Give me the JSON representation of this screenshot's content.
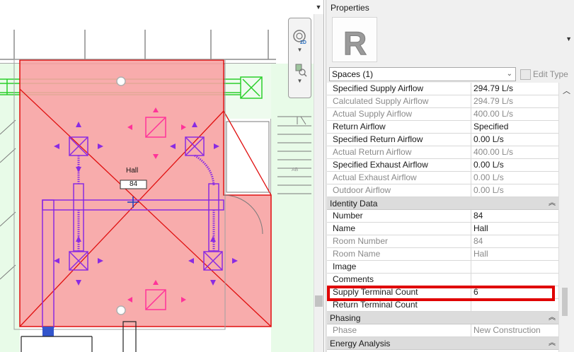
{
  "canvas": {
    "menu_arrow_icon": "dropdown-triangle",
    "room_label": "Hall",
    "room_number": "84",
    "small_label": "AB",
    "nav_2d_label": "2D",
    "colors": {
      "space_fill": "#f7a3a3",
      "space_edge": "#e01010",
      "duct": "#8a2be2",
      "terminal": "#ff3399",
      "wall_green": "#2bcf2b"
    }
  },
  "properties": {
    "title": "Properties",
    "type_image_letter": "R",
    "type_selector": "Spaces (1)",
    "edit_type": "Edit Type",
    "groups": [
      {
        "label": null,
        "rows": [
          {
            "name": "Specified Supply Airflow",
            "value": "294.79 L/s",
            "readonly": false
          },
          {
            "name": "Calculated Supply Airflow",
            "value": "294.79 L/s",
            "readonly": true
          },
          {
            "name": "Actual Supply Airflow",
            "value": "400.00 L/s",
            "readonly": true
          },
          {
            "name": "Return Airflow",
            "value": "Specified",
            "readonly": false
          },
          {
            "name": "Specified Return Airflow",
            "value": "0.00 L/s",
            "readonly": false
          },
          {
            "name": "Actual Return Airflow",
            "value": "400.00 L/s",
            "readonly": true
          },
          {
            "name": "Specified Exhaust Airflow",
            "value": "0.00 L/s",
            "readonly": false
          },
          {
            "name": "Actual Exhaust Airflow",
            "value": "0.00 L/s",
            "readonly": true
          },
          {
            "name": "Outdoor Airflow",
            "value": "0.00 L/s",
            "readonly": true
          }
        ]
      },
      {
        "label": "Identity Data",
        "rows": [
          {
            "name": "Number",
            "value": "84",
            "readonly": false
          },
          {
            "name": "Name",
            "value": "Hall",
            "readonly": false
          },
          {
            "name": "Room Number",
            "value": "84",
            "readonly": true
          },
          {
            "name": "Room Name",
            "value": "Hall",
            "readonly": true
          },
          {
            "name": "Image",
            "value": "",
            "readonly": false
          },
          {
            "name": "Comments",
            "value": "",
            "readonly": false
          },
          {
            "name": "Supply Terminal Count",
            "value": "6",
            "readonly": false
          },
          {
            "name": "Return Terminal Count",
            "value": "",
            "readonly": false
          }
        ]
      },
      {
        "label": "Phasing",
        "rows": [
          {
            "name": "Phase",
            "value": "New Construction",
            "readonly": true
          }
        ]
      },
      {
        "label": "Energy Analysis",
        "rows": []
      }
    ],
    "collapse_icon": "double-chevron-up"
  }
}
